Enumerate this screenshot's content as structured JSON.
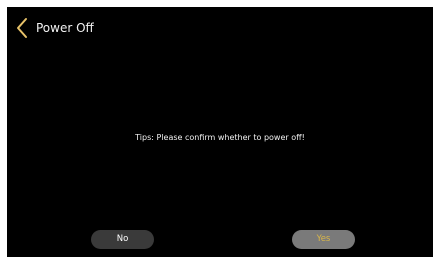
{
  "header": {
    "back_icon": "chevron-left-icon",
    "title": "Power Off"
  },
  "dialog": {
    "message": "Tips: Please confirm whether to power off!"
  },
  "buttons": {
    "no_label": "No",
    "yes_label": "Yes"
  },
  "colors": {
    "background": "#000000",
    "back_icon": "#e8c36a",
    "no_button_bg": "#3a3a3a",
    "yes_button_bg": "#7a7a7a",
    "yes_button_text": "#d8b64a"
  }
}
